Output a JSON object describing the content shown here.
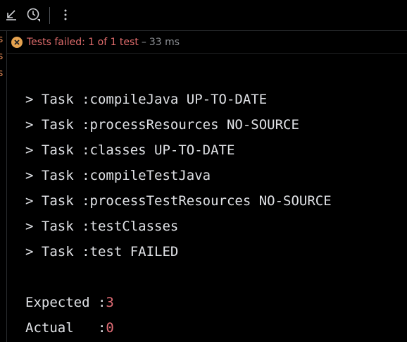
{
  "toolbar": {
    "collapse_icon": "collapse-arrow-icon",
    "history_icon": "history-clock-icon",
    "more_icon": "more-vertical-icon"
  },
  "left_strip": {
    "fragments": [
      "s",
      "s",
      "s"
    ]
  },
  "status": {
    "icon": "error-x-circle-icon",
    "failed_text": "Tests failed: 1 of 1 test",
    "dash": "–",
    "duration": "33 ms"
  },
  "console": {
    "tasks": [
      "> Task :compileJava UP-TO-DATE",
      "> Task :processResources NO-SOURCE",
      "> Task :classes UP-TO-DATE",
      "> Task :compileTestJava",
      "> Task :processTestResources NO-SOURCE",
      "> Task :testClasses",
      "> Task :test FAILED"
    ],
    "expected_label": "Expected :",
    "expected_value": "3",
    "actual_label": "Actual   :",
    "actual_value": "0"
  }
}
